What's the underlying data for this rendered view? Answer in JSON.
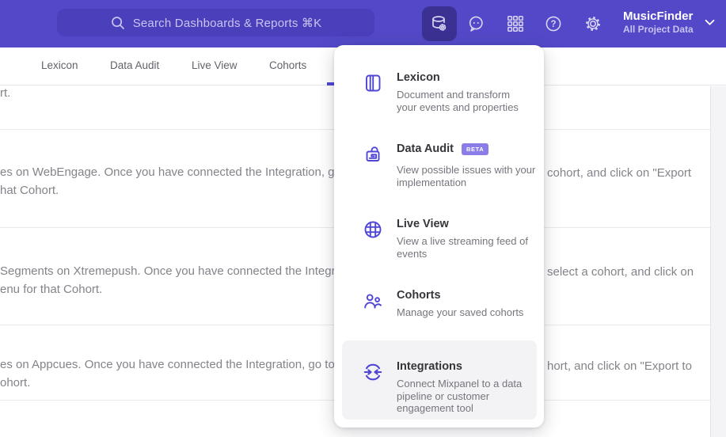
{
  "header": {
    "search": {
      "placeholder": "Search Dashboards & Reports ⌘K"
    },
    "project": {
      "name": "MusicFinder",
      "scope": "All Project Data"
    }
  },
  "nav": {
    "tabs": [
      {
        "label": "Lexicon"
      },
      {
        "label": "Data Audit"
      },
      {
        "label": "Live View"
      },
      {
        "label": "Cohorts"
      }
    ]
  },
  "menu": {
    "items": [
      {
        "title": "Lexicon",
        "desc": "Document and transform\nyour events and properties"
      },
      {
        "title": "Data Audit",
        "badge": "BETA",
        "desc": "View possible issues with your\nimplementation"
      },
      {
        "title": "Live View",
        "desc": "View a live streaming feed of\nevents"
      },
      {
        "title": "Cohorts",
        "desc": "Manage your saved cohorts"
      },
      {
        "title": "Integrations",
        "desc": "Connect Mixpanel to a data\npipeline or customer\nengagement tool"
      }
    ]
  },
  "content": {
    "tail": "rt.",
    "rows": [
      {
        "left1": "es on WebEngage. Once you have connected the Integration, go to the",
        "right1": "cohort, and click on \"Export",
        "line2": "hat Cohort."
      },
      {
        "left1": "Segments on Xtremepush. Once you have connected the Integration, g",
        "right1": "select a cohort, and click on",
        "line2": "enu for that Cohort."
      },
      {
        "left1": "es on Appcues. Once you have connected the Integration, go to the M",
        "right1": "hort, and click on \"Export to",
        "line2": "ohort."
      }
    ]
  },
  "colors": {
    "header_bg": "#5349c8",
    "search_bg": "#4a40bb",
    "tile_bg": "#3b3193",
    "accent": "#4f46d6",
    "badge_bg": "#8b7de7",
    "highlight": "#f3f3f5",
    "gutter": "#f4f4f6",
    "content_text": "#83838a"
  }
}
